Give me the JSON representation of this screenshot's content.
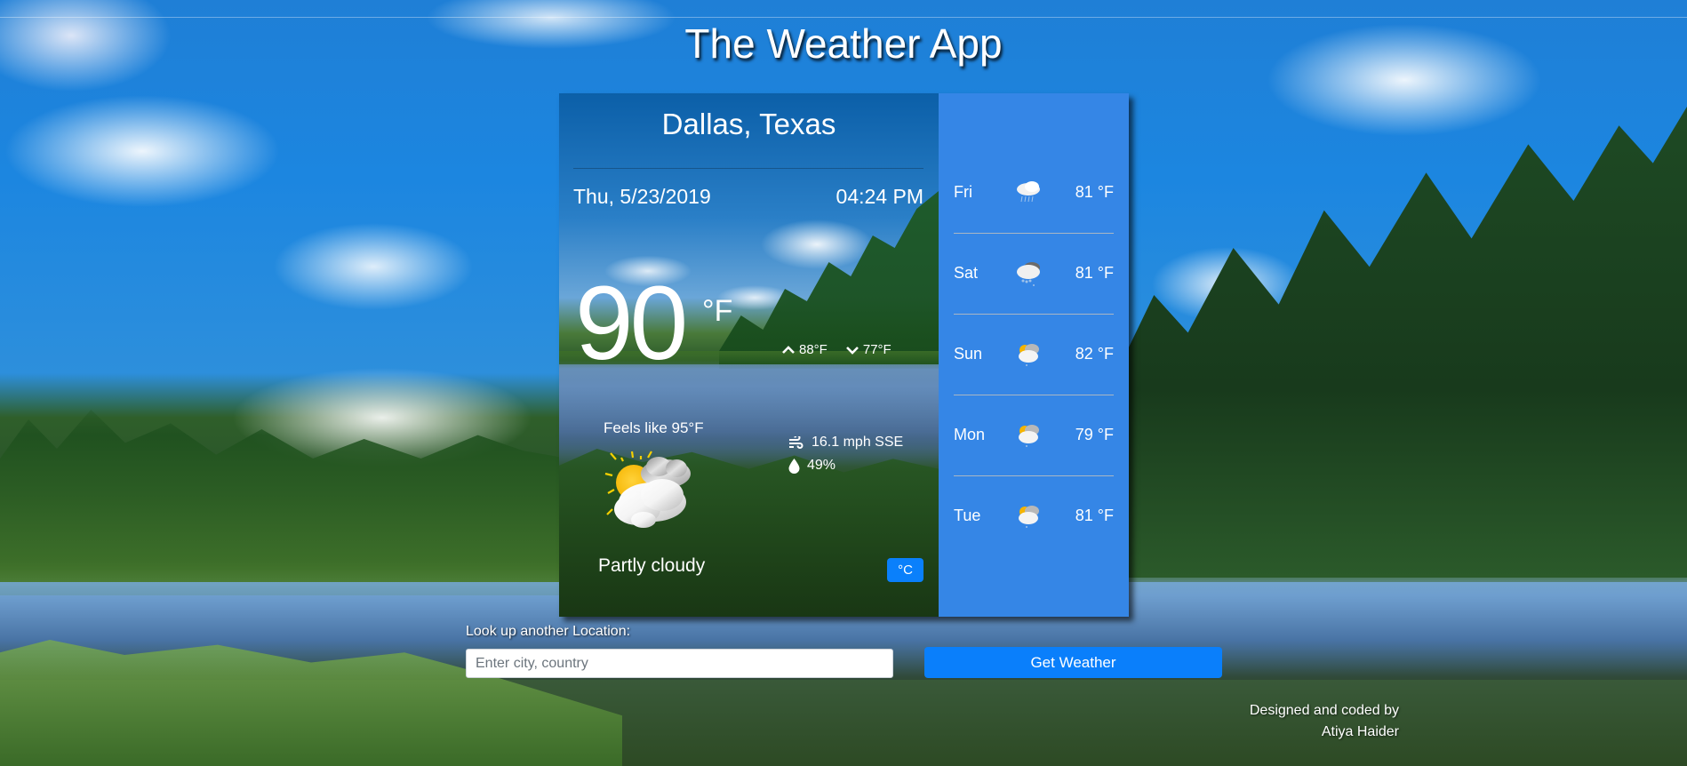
{
  "app": {
    "title": "The Weather App"
  },
  "current": {
    "location": "Dallas, Texas",
    "date": "Thu, 5/23/2019",
    "time": "04:24 PM",
    "temperature": "90",
    "temperature_unit": "°F",
    "high": "88°F",
    "low": "77°F",
    "feels_like": "Feels like 95°F",
    "wind": "16.1 mph SSE",
    "humidity": "49%",
    "condition": "Partly cloudy",
    "condition_icon": "partly-cloudy-icon",
    "unit_toggle_label": "°C"
  },
  "forecast": [
    {
      "day": "Fri",
      "icon": "rain-cloud-icon",
      "temp": "81 °F"
    },
    {
      "day": "Sat",
      "icon": "thunder-rain-icon",
      "temp": "81 °F"
    },
    {
      "day": "Sun",
      "icon": "partly-cloudy-rain-icon",
      "temp": "82 °F"
    },
    {
      "day": "Mon",
      "icon": "partly-cloudy-rain-icon",
      "temp": "79 °F"
    },
    {
      "day": "Tue",
      "icon": "partly-cloudy-rain-icon",
      "temp": "81 °F"
    }
  ],
  "search": {
    "label": "Look up another Location:",
    "value": "",
    "placeholder": "Enter city, country",
    "button_label": "Get Weather"
  },
  "footer": {
    "line1": "Designed and coded by",
    "line2": "Atiya Haider"
  },
  "colors": {
    "forecast_panel": "#3586e6",
    "primary_button": "#0a7ffb"
  }
}
